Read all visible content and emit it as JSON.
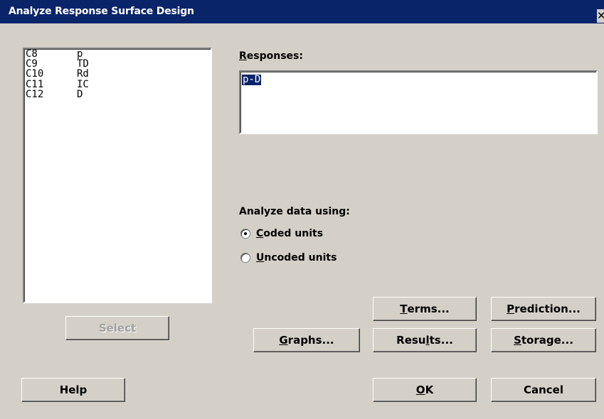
{
  "window": {
    "title": "Analyze Response Surface Design",
    "close": "✕"
  },
  "variables": [
    {
      "col": "C8",
      "name": "p"
    },
    {
      "col": "C9",
      "name": "TD"
    },
    {
      "col": "C10",
      "name": "Rd"
    },
    {
      "col": "C11",
      "name": "IC"
    },
    {
      "col": "C12",
      "name": "D"
    }
  ],
  "responses": {
    "label_accel": "R",
    "label_rest": "esponses:",
    "value": "p-D"
  },
  "analyze": {
    "label": "Analyze data using:",
    "options": [
      {
        "accel": "C",
        "rest": "oded units",
        "selected": true
      },
      {
        "accel": "U",
        "rest": "ncoded units",
        "selected": false
      }
    ]
  },
  "buttons": {
    "select": "Select",
    "help": "Help",
    "terms": {
      "accel": "T",
      "rest": "erms..."
    },
    "prediction": {
      "accel": "P",
      "rest": "rediction..."
    },
    "graphs": {
      "accel": "G",
      "rest": "raphs..."
    },
    "results": {
      "pre": "Resu",
      "accel": "l",
      "rest": "ts..."
    },
    "storage": {
      "accel": "S",
      "rest": "torage..."
    },
    "ok": {
      "accel": "O",
      "rest": "K"
    },
    "cancel": "Cancel"
  },
  "colors": {
    "face": "#d4d0c8",
    "titlebar": "#0a246a",
    "highlight": "#0a246a"
  }
}
